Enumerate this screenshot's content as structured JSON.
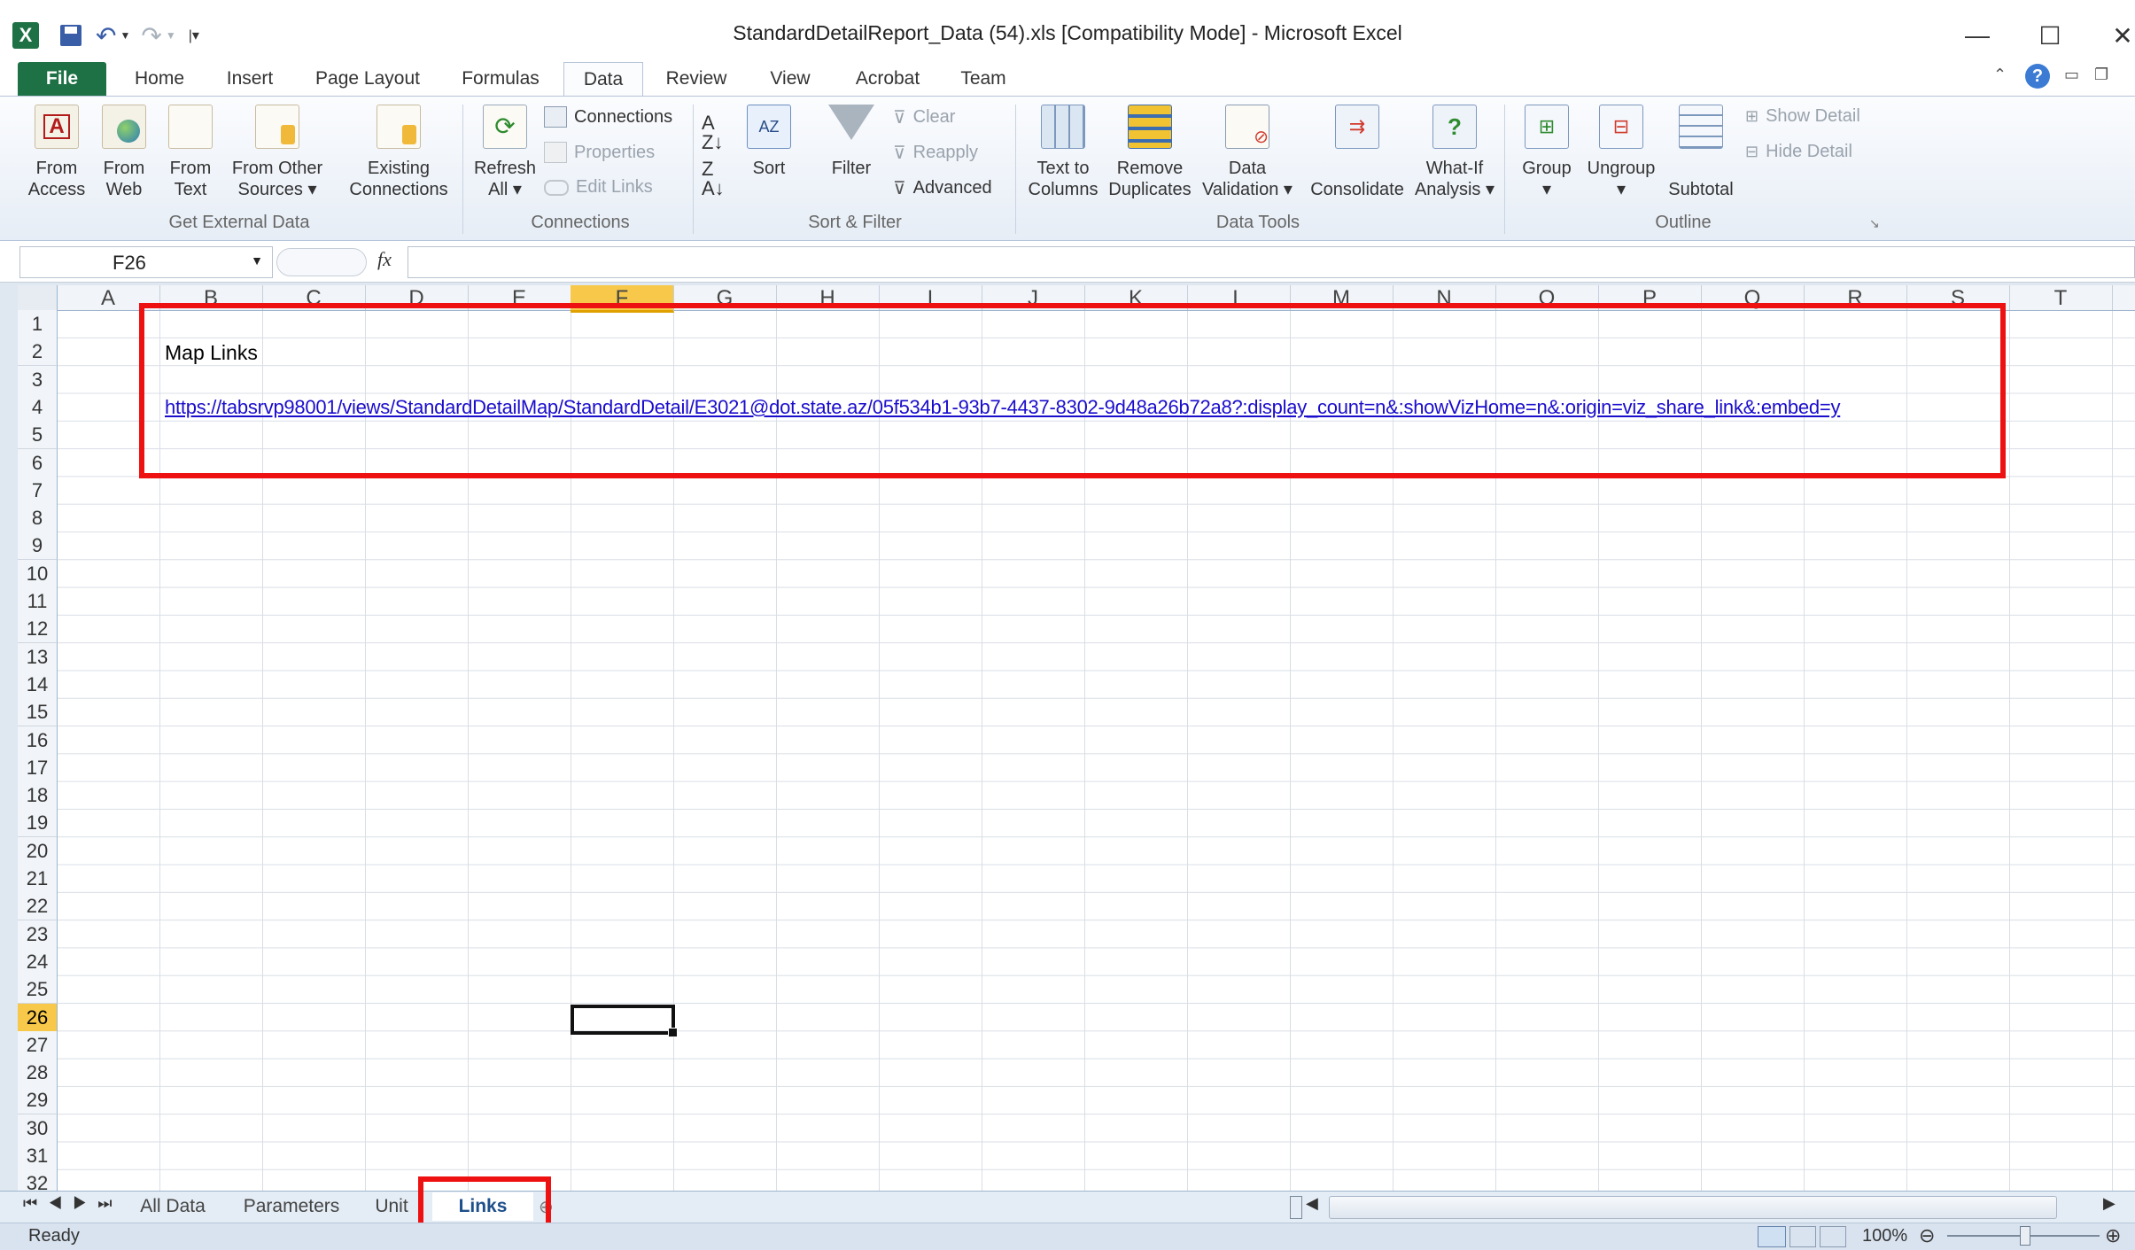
{
  "window": {
    "title": "StandardDetailReport_Data (54).xls  [Compatibility Mode]  -  Microsoft Excel",
    "controls": [
      "—",
      "☐",
      "✕"
    ]
  },
  "tabs": [
    {
      "label": "File"
    },
    {
      "label": "Home"
    },
    {
      "label": "Insert"
    },
    {
      "label": "Page Layout"
    },
    {
      "label": "Formulas"
    },
    {
      "label": "Data"
    },
    {
      "label": "Review"
    },
    {
      "label": "View"
    },
    {
      "label": "Acrobat"
    },
    {
      "label": "Team"
    }
  ],
  "active_tab": "Data",
  "ribbon": {
    "get_external_data": {
      "group_label": "Get External Data",
      "from_access": "From\nAccess",
      "from_web": "From\nWeb",
      "from_text": "From\nText",
      "from_other": "From Other\nSources ▾",
      "existing": "Existing\nConnections"
    },
    "connections": {
      "group_label": "Connections",
      "refresh": "Refresh\nAll ▾",
      "connections": "Connections",
      "properties": "Properties",
      "edit_links": "Edit Links"
    },
    "sort_filter": {
      "group_label": "Sort & Filter",
      "sort": "Sort",
      "filter": "Filter",
      "clear": "Clear",
      "reapply": "Reapply",
      "advanced": "Advanced"
    },
    "data_tools": {
      "group_label": "Data Tools",
      "text_to_columns": "Text to\nColumns",
      "remove_duplicates": "Remove\nDuplicates",
      "data_validation": "Data\nValidation ▾",
      "consolidate": "Consolidate",
      "what_if": "What-If\nAnalysis ▾"
    },
    "outline": {
      "group_label": "Outline",
      "group": "Group\n▾",
      "ungroup": "Ungroup\n▾",
      "subtotal": "Subtotal",
      "show_detail": "Show Detail",
      "hide_detail": "Hide Detail"
    }
  },
  "formula_bar": {
    "name_box": "F26",
    "fx": "fx",
    "formula": ""
  },
  "columns": [
    "A",
    "B",
    "C",
    "D",
    "E",
    "F",
    "G",
    "H",
    "I",
    "J",
    "K",
    "L",
    "M",
    "N",
    "O",
    "P",
    "Q",
    "R",
    "S",
    "T"
  ],
  "rows": [
    "1",
    "2",
    "3",
    "4",
    "5",
    "6",
    "7",
    "8",
    "9",
    "10",
    "11",
    "12",
    "13",
    "14",
    "15",
    "16",
    "17",
    "18",
    "19",
    "20",
    "21",
    "22",
    "23",
    "24",
    "25",
    "26",
    "27",
    "28",
    "29",
    "30",
    "31",
    "32"
  ],
  "selected_cell": "F26",
  "cells": {
    "B2": "Map Links",
    "B4": "https://tabsrvp98001/views/StandardDetailMap/StandardDetail/E3021@dot.state.az/05f534b1-93b7-4437-8302-9d48a26b72a8?:display_count=n&:showVizHome=n&:origin=viz_share_link&:embed=y"
  },
  "sheet_tabs": [
    "All Data",
    "Parameters",
    "Unit",
    "Links"
  ],
  "active_sheet": "Links",
  "status": {
    "ready": "Ready",
    "zoom": "100%"
  },
  "colors": {
    "excel_green": "#1e7145",
    "highlight_red": "#ee1111",
    "link_blue": "#1a0dcc",
    "selected_header": "#f7c84a"
  }
}
